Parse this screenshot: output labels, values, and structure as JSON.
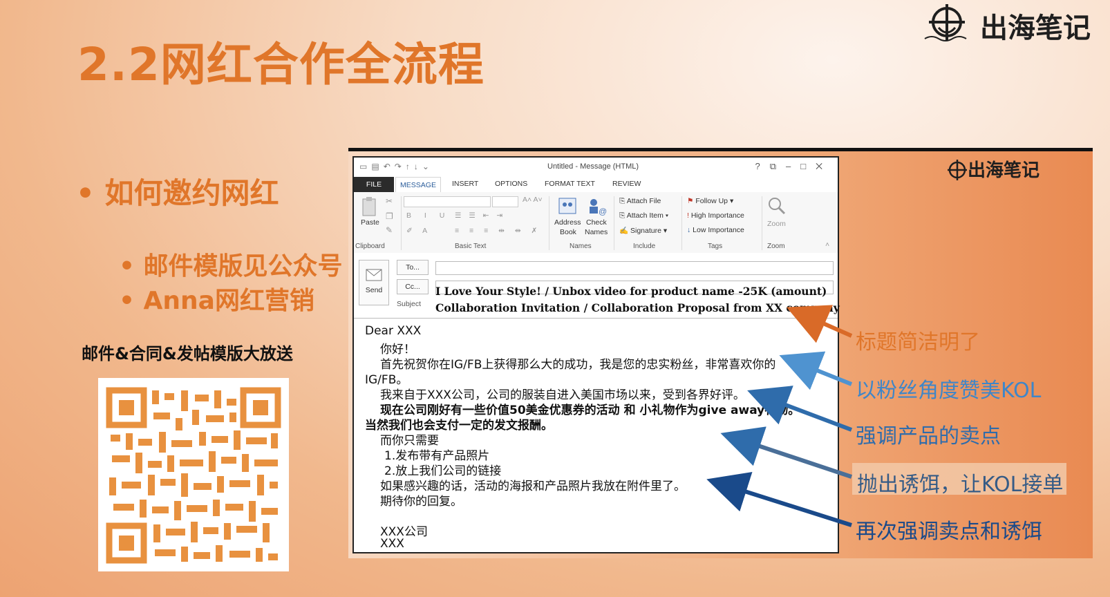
{
  "slide": {
    "title": "2.2网红合作全流程",
    "logo_text": "出海笔记",
    "bullet_main": "•  如何邀约网红",
    "bullet_sub1": "•  邮件模版见公众号",
    "bullet_sub2": "•  Anna网红营销",
    "giveaway_text": "邮件&合同&发帖模版大放送",
    "panel_logo_text": "出海笔记"
  },
  "outlook": {
    "window_title": "Untitled - Message (HTML)",
    "quick_access": [
      "save-icon",
      "undo-icon",
      "redo-icon",
      "up-icon",
      "down-icon"
    ],
    "window_controls": [
      "?",
      "⧉",
      "–",
      "□",
      "✕"
    ],
    "tabs": [
      "FILE",
      "MESSAGE",
      "INSERT",
      "OPTIONS",
      "FORMAT TEXT",
      "REVIEW"
    ],
    "active_tab": "MESSAGE",
    "ribbon": {
      "paste": "Paste",
      "clipboard": "Clipboard",
      "basic_text": "Basic Text",
      "address_book_1": "Address",
      "address_book_2": "Book",
      "check_names_1": "Check",
      "check_names_2": "Names",
      "names": "Names",
      "attach_file": "Attach File",
      "attach_item": "Attach Item",
      "signature": "Signature",
      "include": "Include",
      "follow_up": "Follow Up",
      "high_importance": "High Importance",
      "low_importance": "Low Importance",
      "tags": "Tags",
      "zoom_btn": "Zoom",
      "zoom_grp": "Zoom"
    },
    "send_label": "Send",
    "to_label": "To...",
    "cc_label": "Cc...",
    "subject_label": "Subject",
    "subject_line1": "I Love Your Style!  / Unbox video for product name -25K (amount)",
    "subject_line2": "Collaboration Invitation / Collaboration Proposal from XX company",
    "body": [
      "Dear XXX",
      "你好！",
      "首先祝贺你在IG/FB上获得那么大的成功，我是您的忠实粉丝，非常喜欢你的",
      "IG/FB。",
      "我来自于XXX公司，公司的服装自进入美国市场以来，受到各界好评。",
      "现在公司刚好有一些价值50美金优惠券的活动 和 小礼物作为give away礼物。",
      "当然我们也会支付一定的发文报酬。",
      "而你只需要",
      "1.发布带有产品照片",
      "2.放上我们公司的链接",
      "如果感兴趣的话，活动的海报和产品照片我放在附件里了。",
      "期待你的回复。",
      "XXX公司",
      "XXX"
    ]
  },
  "callouts": {
    "c1": "标题简洁明了",
    "c2": "以粉丝角度赞美KOL",
    "c3": "强调产品的卖点",
    "c4": "抛出诱饵，让KOL接单",
    "c5": "再次强调卖点和诱饵"
  },
  "colors": {
    "accent_orange": "#e0762a",
    "light_blue": "#3f86c8",
    "navy": "#1a4a8a"
  }
}
